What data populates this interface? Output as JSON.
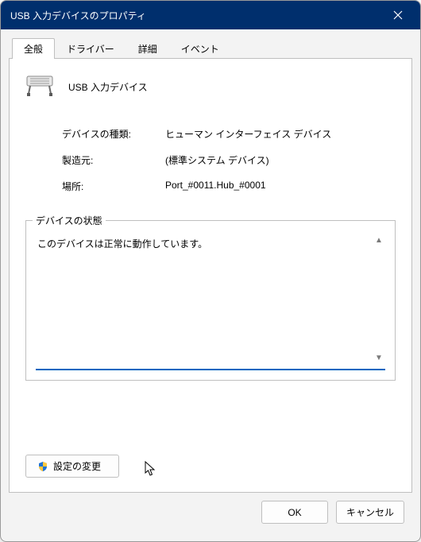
{
  "window": {
    "title": "USB 入力デバイスのプロパティ"
  },
  "tabs": [
    {
      "label": "全般"
    },
    {
      "label": "ドライバー"
    },
    {
      "label": "詳細"
    },
    {
      "label": "イベント"
    }
  ],
  "device": {
    "title": "USB 入力デバイス"
  },
  "info": {
    "type_label": "デバイスの種類:",
    "type_value": "ヒューマン インターフェイス デバイス",
    "manufacturer_label": "製造元:",
    "manufacturer_value": "(標準システム デバイス)",
    "location_label": "場所:",
    "location_value": "Port_#0011.Hub_#0001"
  },
  "status": {
    "legend": "デバイスの状態",
    "text": "このデバイスは正常に動作しています。"
  },
  "buttons": {
    "change_settings": "設定の変更",
    "ok": "OK",
    "cancel": "キャンセル"
  }
}
